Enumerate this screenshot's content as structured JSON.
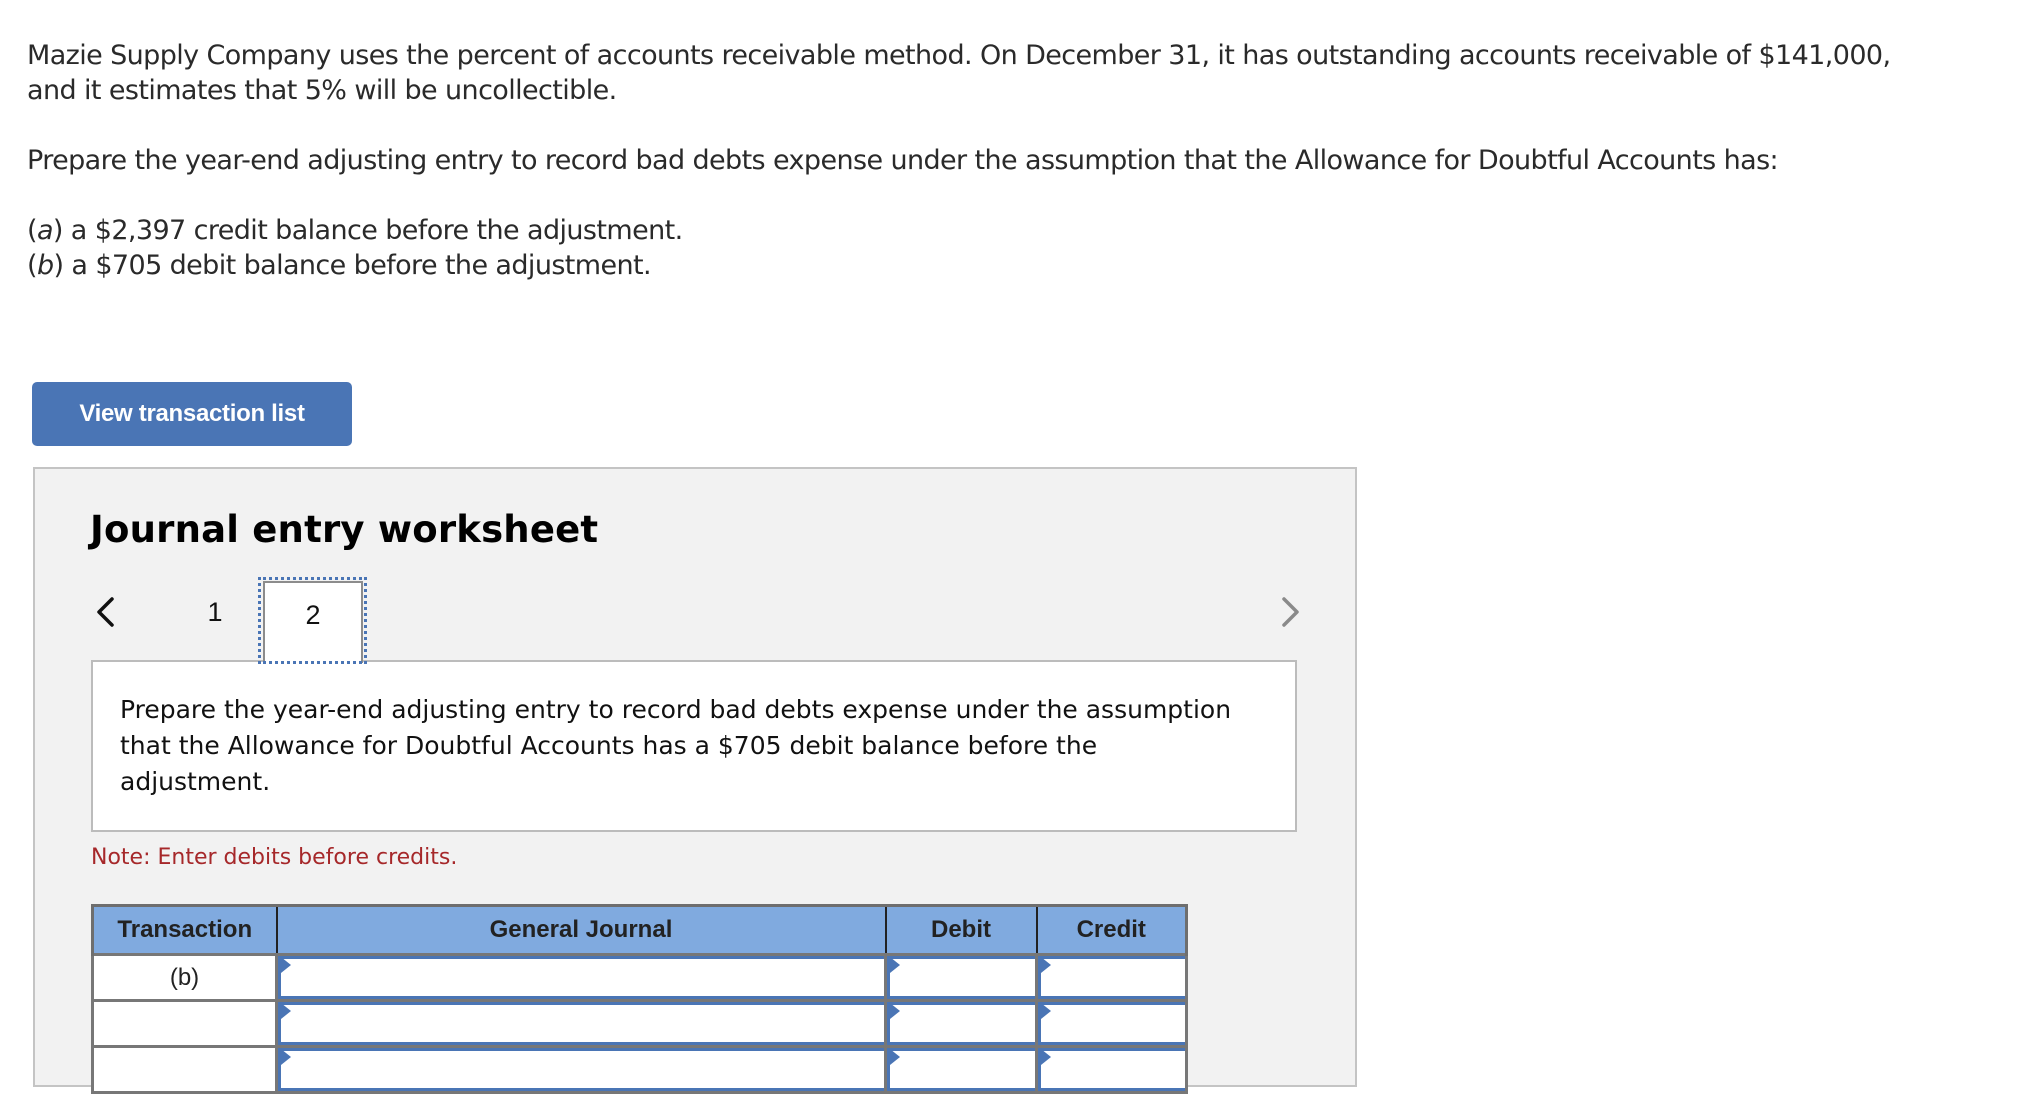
{
  "question": {
    "paragraph1": "Mazie Supply Company uses the percent of accounts receivable method. On December 31, it has outstanding accounts receivable of $141,000, and it estimates that 5% will be uncollectible.",
    "paragraph2": "Prepare the year-end adjusting entry to record bad debts expense under the assumption that the Allowance for Doubtful Accounts has:",
    "parts": [
      {
        "letter": "a",
        "text": " a $2,397 credit balance before the adjustment."
      },
      {
        "letter": "b",
        "text": " a $705 debit balance before the adjustment."
      }
    ]
  },
  "toolbar": {
    "view_transaction_list_label": "View transaction list"
  },
  "worksheet": {
    "title": "Journal entry worksheet",
    "icons": {
      "prev": "chevron-left-icon",
      "next": "chevron-right-icon"
    },
    "tabs": [
      {
        "label": "1",
        "active": false
      },
      {
        "label": "2",
        "active": true
      }
    ],
    "instruction": "Prepare the year-end adjusting entry to record bad debts expense under the assumption that the Allowance for Doubtful Accounts has a $705 debit balance before the adjustment.",
    "note": "Note: Enter debits before credits.",
    "colors": {
      "accent": "#4a75b5",
      "header_fill": "#80aadf",
      "note": "#a6282a",
      "panel_bg": "#f2f2f2"
    },
    "table": {
      "headers": [
        "Transaction",
        "General Journal",
        "Debit",
        "Credit"
      ],
      "rows": [
        {
          "transaction": "(b)",
          "general_journal": "",
          "debit": "",
          "credit": ""
        },
        {
          "transaction": "",
          "general_journal": "",
          "debit": "",
          "credit": ""
        },
        {
          "transaction": "",
          "general_journal": "",
          "debit": "",
          "credit": ""
        }
      ]
    }
  }
}
